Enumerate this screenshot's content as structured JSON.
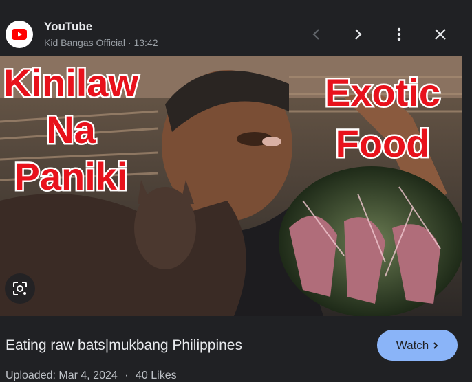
{
  "header": {
    "source_name": "YouTube",
    "channel": "Kid Bangas Official",
    "separator": "·",
    "duration": "13:42",
    "icons": [
      "youtube-logo-icon",
      "chevron-left-icon",
      "chevron-right-icon",
      "more-vert-icon",
      "close-icon"
    ]
  },
  "thumbnail": {
    "overlay_left": [
      "Kinilaw",
      "Na",
      "Paniki"
    ],
    "overlay_right": [
      "Exotic",
      "Food"
    ],
    "lens_icon": "google-lens-icon"
  },
  "result": {
    "title": "Eating raw bats|mukbang Philippines",
    "watch_label": "Watch",
    "uploaded": "Uploaded: Mar 4, 2024",
    "meta_separator": "·",
    "likes": "40 Likes"
  },
  "colors": {
    "background": "#202124",
    "watch_button": "#8ab4f8",
    "youtube_red": "#ff0000",
    "overlay_text_red": "#e8121c"
  }
}
